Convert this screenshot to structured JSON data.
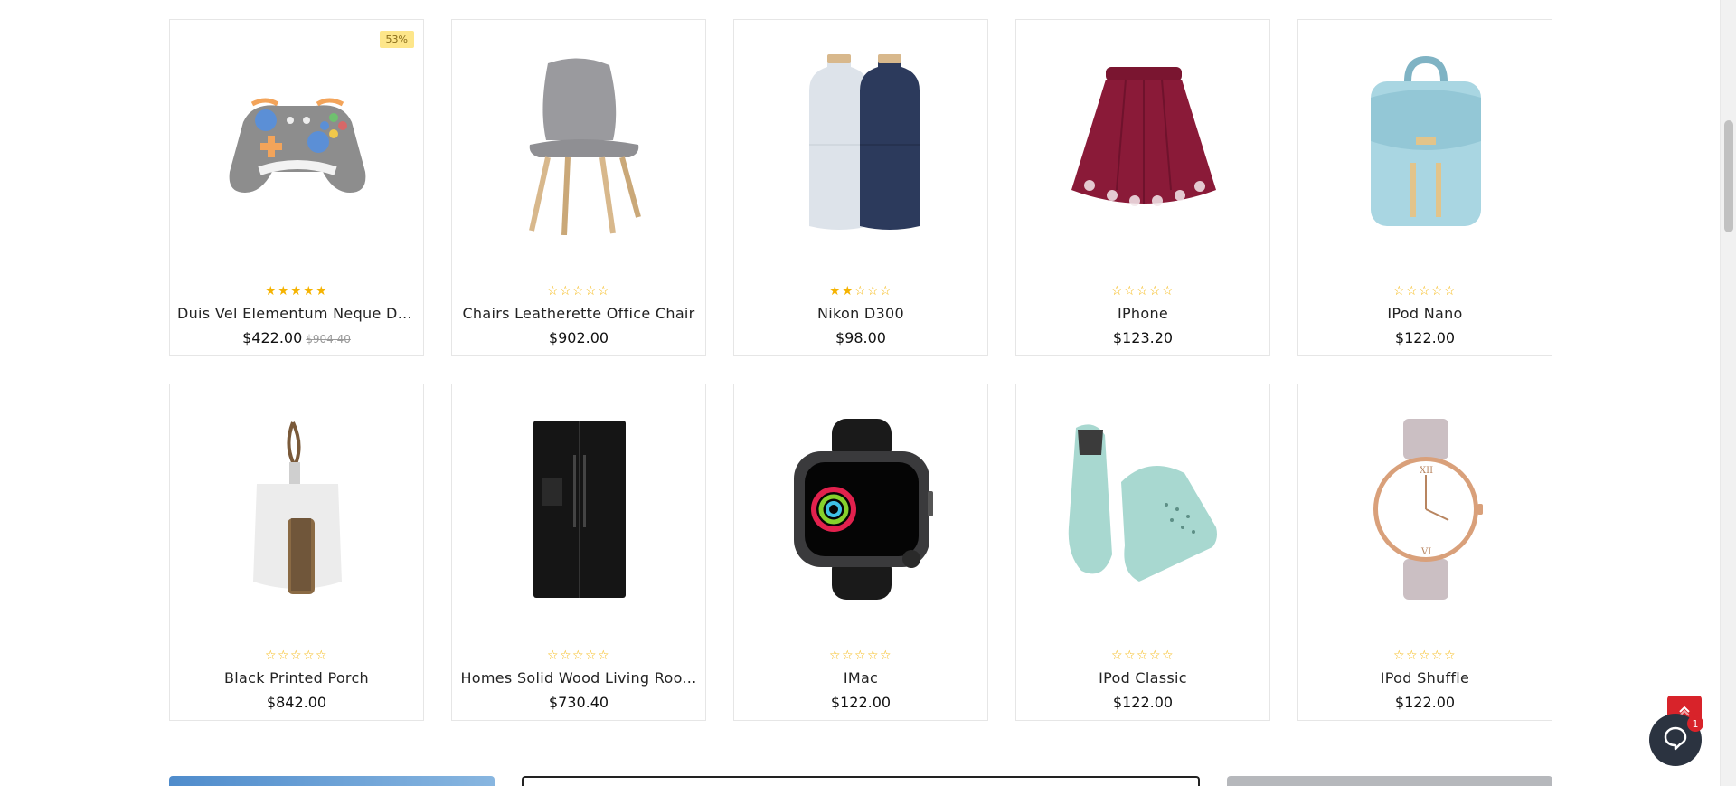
{
  "products": [
    {
      "name": "Duis Vel Elementum Neque Do...",
      "price": "$422.00",
      "old_price": "$904.40",
      "badge": "53%",
      "rating": 5,
      "image": "game-controller"
    },
    {
      "name": "Chairs Leatherette Office Chair",
      "price": "$902.00",
      "old_price": "",
      "badge": "",
      "rating": 0,
      "image": "chair"
    },
    {
      "name": "Nikon D300",
      "price": "$98.00",
      "old_price": "",
      "badge": "",
      "rating": 2,
      "image": "salt-pepper-mills"
    },
    {
      "name": "IPhone",
      "price": "$123.20",
      "old_price": "",
      "badge": "",
      "rating": 0,
      "image": "skirt"
    },
    {
      "name": "IPod Nano",
      "price": "$122.00",
      "old_price": "",
      "badge": "",
      "rating": 0,
      "image": "backpack"
    },
    {
      "name": "Black Printed Porch",
      "price": "$842.00",
      "old_price": "",
      "badge": "",
      "rating": 0,
      "image": "dustpan-brush"
    },
    {
      "name": "Homes Solid Wood Living Roo...",
      "price": "$730.40",
      "old_price": "",
      "badge": "",
      "rating": 0,
      "image": "refrigerator"
    },
    {
      "name": "IMac",
      "price": "$122.00",
      "old_price": "",
      "badge": "",
      "rating": 0,
      "image": "smart-watch"
    },
    {
      "name": "IPod Classic",
      "price": "$122.00",
      "old_price": "",
      "badge": "",
      "rating": 0,
      "image": "sneakers"
    },
    {
      "name": "IPod Shuffle",
      "price": "$122.00",
      "old_price": "",
      "badge": "",
      "rating": 0,
      "image": "wrist-watch"
    }
  ],
  "rating_max": 5,
  "colors": {
    "star": "#f5b301",
    "badge_bg": "#fde68a",
    "to_top_bg": "#d8232a",
    "chat_bg": "#2b3340"
  },
  "chat": {
    "unread_count": "1"
  },
  "icons": {
    "to_top": "chevron-up-icon",
    "chat": "chat-bubble-icon"
  }
}
